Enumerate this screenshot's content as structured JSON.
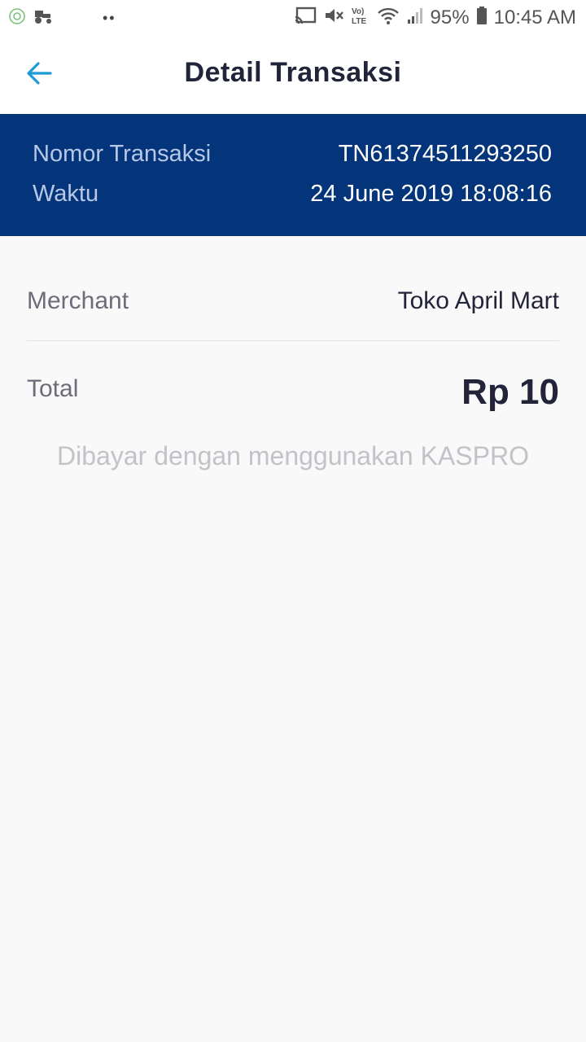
{
  "status_bar": {
    "battery": "95%",
    "time": "10:45 AM",
    "network_label": "Vo) LTE",
    "notif_dots": "••",
    "icons": [
      "vpn-icon",
      "tractor-icon",
      "cast-icon",
      "mute-icon",
      "volte-icon",
      "wifi-icon",
      "signal-icon",
      "battery-icon"
    ]
  },
  "app_bar": {
    "title": "Detail Transaksi",
    "back_icon": "arrow-left-icon",
    "accent": "#1e9ad6"
  },
  "transaction": {
    "number_label": "Nomor Transaksi",
    "number": "TN61374511293250",
    "time_label": "Waktu",
    "time": "24 June 2019 18:08:16",
    "header_color": "#04357a"
  },
  "detail": {
    "merchant_label": "Merchant",
    "merchant": "Toko April Mart",
    "total_label": "Total",
    "total": "Rp 10",
    "paid_note": "Dibayar dengan menggunakan KASPRO"
  }
}
